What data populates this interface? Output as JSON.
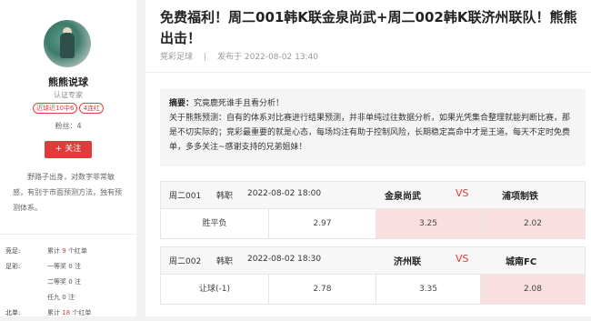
{
  "sidebar": {
    "username": "熊熊说球",
    "role": "认证专家",
    "tags": [
      "近球近10中6",
      "4连红"
    ],
    "fans": "粉丝：4",
    "follow_label": "+ 关注",
    "bio": "野路子出身，对数字非常敏感，有别于市面预测方法，独有预测体系。",
    "stats": [
      {
        "key": "竞足:",
        "pre": "累计",
        "num": "9",
        "post": "个红单"
      },
      {
        "key": "足彩:",
        "pre": "一等奖",
        "num": "0",
        "post": "注"
      },
      {
        "key": "",
        "pre": "二等奖",
        "num": "0",
        "post": "注"
      },
      {
        "key": "",
        "pre": "任九",
        "num": "0",
        "post": "注"
      },
      {
        "key": "北单:",
        "pre": "累计",
        "num": "18",
        "post": "个红单"
      }
    ]
  },
  "article": {
    "title": "免费福利！周二001韩K联金泉尚武+周二002韩K联济州联队！熊熊出击！",
    "category": "竞彩足球",
    "published": "发布于 2022-08-02 13:40",
    "summary_label": "摘要：",
    "summary_headline": "究竟鹿死谁手且看分析！",
    "summary_body": "关于熊熊预测：自有的体系对比赛进行结果预测，并非单纯过往数据分析，如果光凭集合整理就能判断比赛，那是不切实际的；竞彩最重要的就是心态，每场均注有助于控制风险，长期稳定高命中才是王道。每天不定时免费单，多多关注~感谢支持的兄弟姐妹！"
  },
  "matches": [
    {
      "code": "周二001",
      "league": "韩职",
      "time": "2022-08-02 18:00",
      "home": "金泉尚武",
      "vs": "VS",
      "away": "浦项制铁",
      "market": "胜平负",
      "odds": [
        "2.97",
        "3.25",
        "2.02"
      ],
      "picked": [
        false,
        true,
        true
      ]
    },
    {
      "code": "周二002",
      "league": "韩职",
      "time": "2022-08-02 18:30",
      "home": "济州联",
      "vs": "VS",
      "away": "城南FC",
      "market": "让球(-1)",
      "odds": [
        "2.78",
        "3.35",
        "2.08"
      ],
      "picked": [
        false,
        false,
        true
      ]
    }
  ],
  "colors": {
    "accent": "#e23a3a",
    "pick_bg": "#f9dfe0"
  }
}
